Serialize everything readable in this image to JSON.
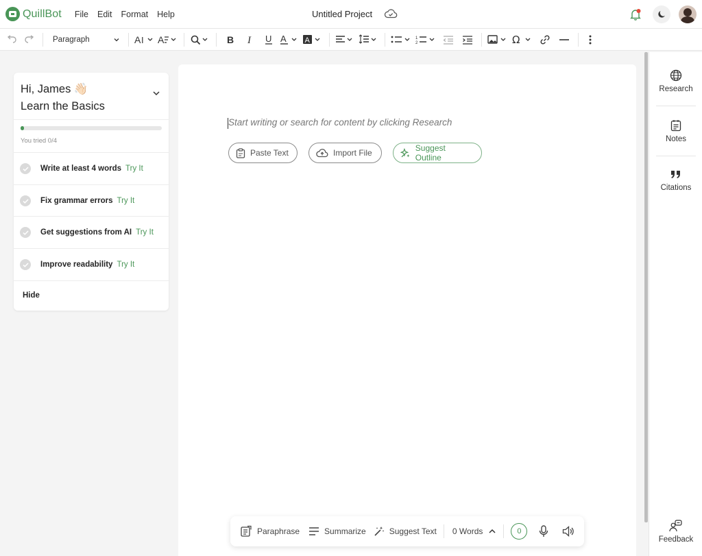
{
  "header": {
    "brand": "QuillBot",
    "menu": [
      "File",
      "Edit",
      "Format",
      "Help"
    ],
    "project_title": "Untitled Project"
  },
  "toolbar": {
    "block_style": "Paragraph",
    "icons": [
      "undo-icon",
      "redo-icon",
      "font-size-icon",
      "text-style-icon",
      "find-replace-icon",
      "bold-icon",
      "italic-icon",
      "underline-icon",
      "text-color-icon",
      "highlight-icon",
      "align-icon",
      "line-height-icon",
      "bullet-list-icon",
      "numbered-list-icon",
      "outdent-icon",
      "indent-icon",
      "image-icon",
      "special-char-icon",
      "link-icon",
      "horizontal-rule-icon",
      "more-icon"
    ]
  },
  "onboarding": {
    "greeting": "Hi, James 👋🏻",
    "title": "Learn the Basics",
    "progress_fraction": 0.025,
    "progress_text": "You tried 0/4",
    "tasks": [
      {
        "label": "Write at least 4 words",
        "action": "Try It"
      },
      {
        "label": "Fix grammar errors",
        "action": "Try It"
      },
      {
        "label": "Get suggestions from AI",
        "action": "Try It"
      },
      {
        "label": "Improve readability",
        "action": "Try It"
      }
    ],
    "hide_label": "Hide"
  },
  "editor": {
    "placeholder": "Start writing or search for content by clicking Research",
    "actions": {
      "paste": "Paste Text",
      "import": "Import File",
      "outline": "Suggest Outline"
    }
  },
  "rail": {
    "research": "Research",
    "notes": "Notes",
    "citations": "Citations",
    "feedback": "Feedback"
  },
  "bottom_bar": {
    "paraphrase": "Paraphrase",
    "summarize": "Summarize",
    "suggest_text": "Suggest Text",
    "word_count": "0 Words",
    "score": "0"
  },
  "colors": {
    "brand_green": "#499557",
    "notification_dot": "#e5493a"
  }
}
